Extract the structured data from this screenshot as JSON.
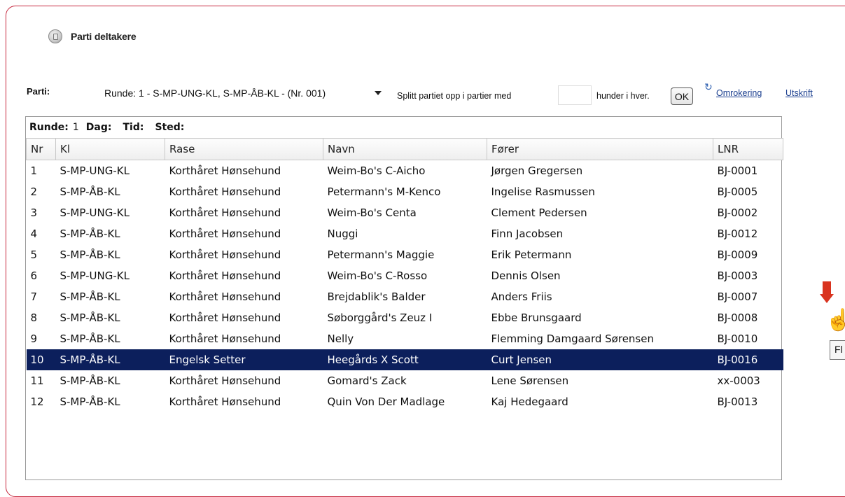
{
  "title": "Parti deltakere",
  "parti": {
    "label": "Parti:",
    "selected": "Runde: 1 - S-MP-UNG-KL, S-MP-ÅB-KL - (Nr. 001)",
    "split_label": "Splitt partiet opp i partier med",
    "split_value": "",
    "split_suffix": "hunder i hver.",
    "ok_label": "OK",
    "omrokering_label": "Omrokering",
    "utskrift_label": "Utskrift"
  },
  "info": {
    "runde_label": "Runde:",
    "runde_value": "1",
    "dag_label": "Dag:",
    "tid_label": "Tid:",
    "sted_label": "Sted:"
  },
  "table": {
    "columns": [
      "Nr",
      "Kl",
      "Rase",
      "Navn",
      "Fører",
      "LNR"
    ],
    "rows": [
      [
        "1",
        "S-MP-UNG-KL",
        "Korthåret Hønsehund",
        "Weim-Bo's C-Aicho",
        "Jørgen Gregersen",
        "BJ-0001"
      ],
      [
        "2",
        "S-MP-ÅB-KL",
        "Korthåret Hønsehund",
        "Petermann's M-Kenco",
        "Ingelise Rasmussen",
        "BJ-0005"
      ],
      [
        "3",
        "S-MP-UNG-KL",
        "Korthåret Hønsehund",
        "Weim-Bo's Centa",
        "Clement Pedersen",
        "BJ-0002"
      ],
      [
        "4",
        "S-MP-ÅB-KL",
        "Korthåret Hønsehund",
        "Nuggi",
        "Finn Jacobsen",
        "BJ-0012"
      ],
      [
        "5",
        "S-MP-ÅB-KL",
        "Korthåret Hønsehund",
        "Petermann's Maggie",
        "Erik Petermann",
        "BJ-0009"
      ],
      [
        "6",
        "S-MP-UNG-KL",
        "Korthåret Hønsehund",
        "Weim-Bo's C-Rosso",
        "Dennis Olsen",
        "BJ-0003"
      ],
      [
        "7",
        "S-MP-ÅB-KL",
        "Korthåret Hønsehund",
        "Brejdablik's Balder",
        "Anders Friis",
        "BJ-0007"
      ],
      [
        "8",
        "S-MP-ÅB-KL",
        "Korthåret Hønsehund",
        "Søborggård's Zeuz I",
        "Ebbe Brunsgaard",
        "BJ-0008"
      ],
      [
        "9",
        "S-MP-ÅB-KL",
        "Korthåret Hønsehund",
        "Nelly",
        "Flemming Damgaard Sørensen",
        "BJ-0010"
      ],
      [
        "10",
        "S-MP-ÅB-KL",
        "Engelsk Setter",
        "Heegårds X Scott",
        "Curt Jensen",
        "BJ-0016"
      ],
      [
        "11",
        "S-MP-ÅB-KL",
        "Korthåret Hønsehund",
        "Gomard's Zack",
        "Lene Sørensen",
        "xx-0003"
      ],
      [
        "12",
        "S-MP-ÅB-KL",
        "Korthåret Hønsehund",
        "Quin Von Der Madlage",
        "Kaj Hedegaard",
        "BJ-0013"
      ]
    ],
    "selected_row": 9
  },
  "tooltip": "Fl",
  "colors": {
    "selected_row": "#0c1f5c",
    "panel_border": "#c6283e",
    "link": "#1b3f8f",
    "arrow": "#d9331f"
  }
}
